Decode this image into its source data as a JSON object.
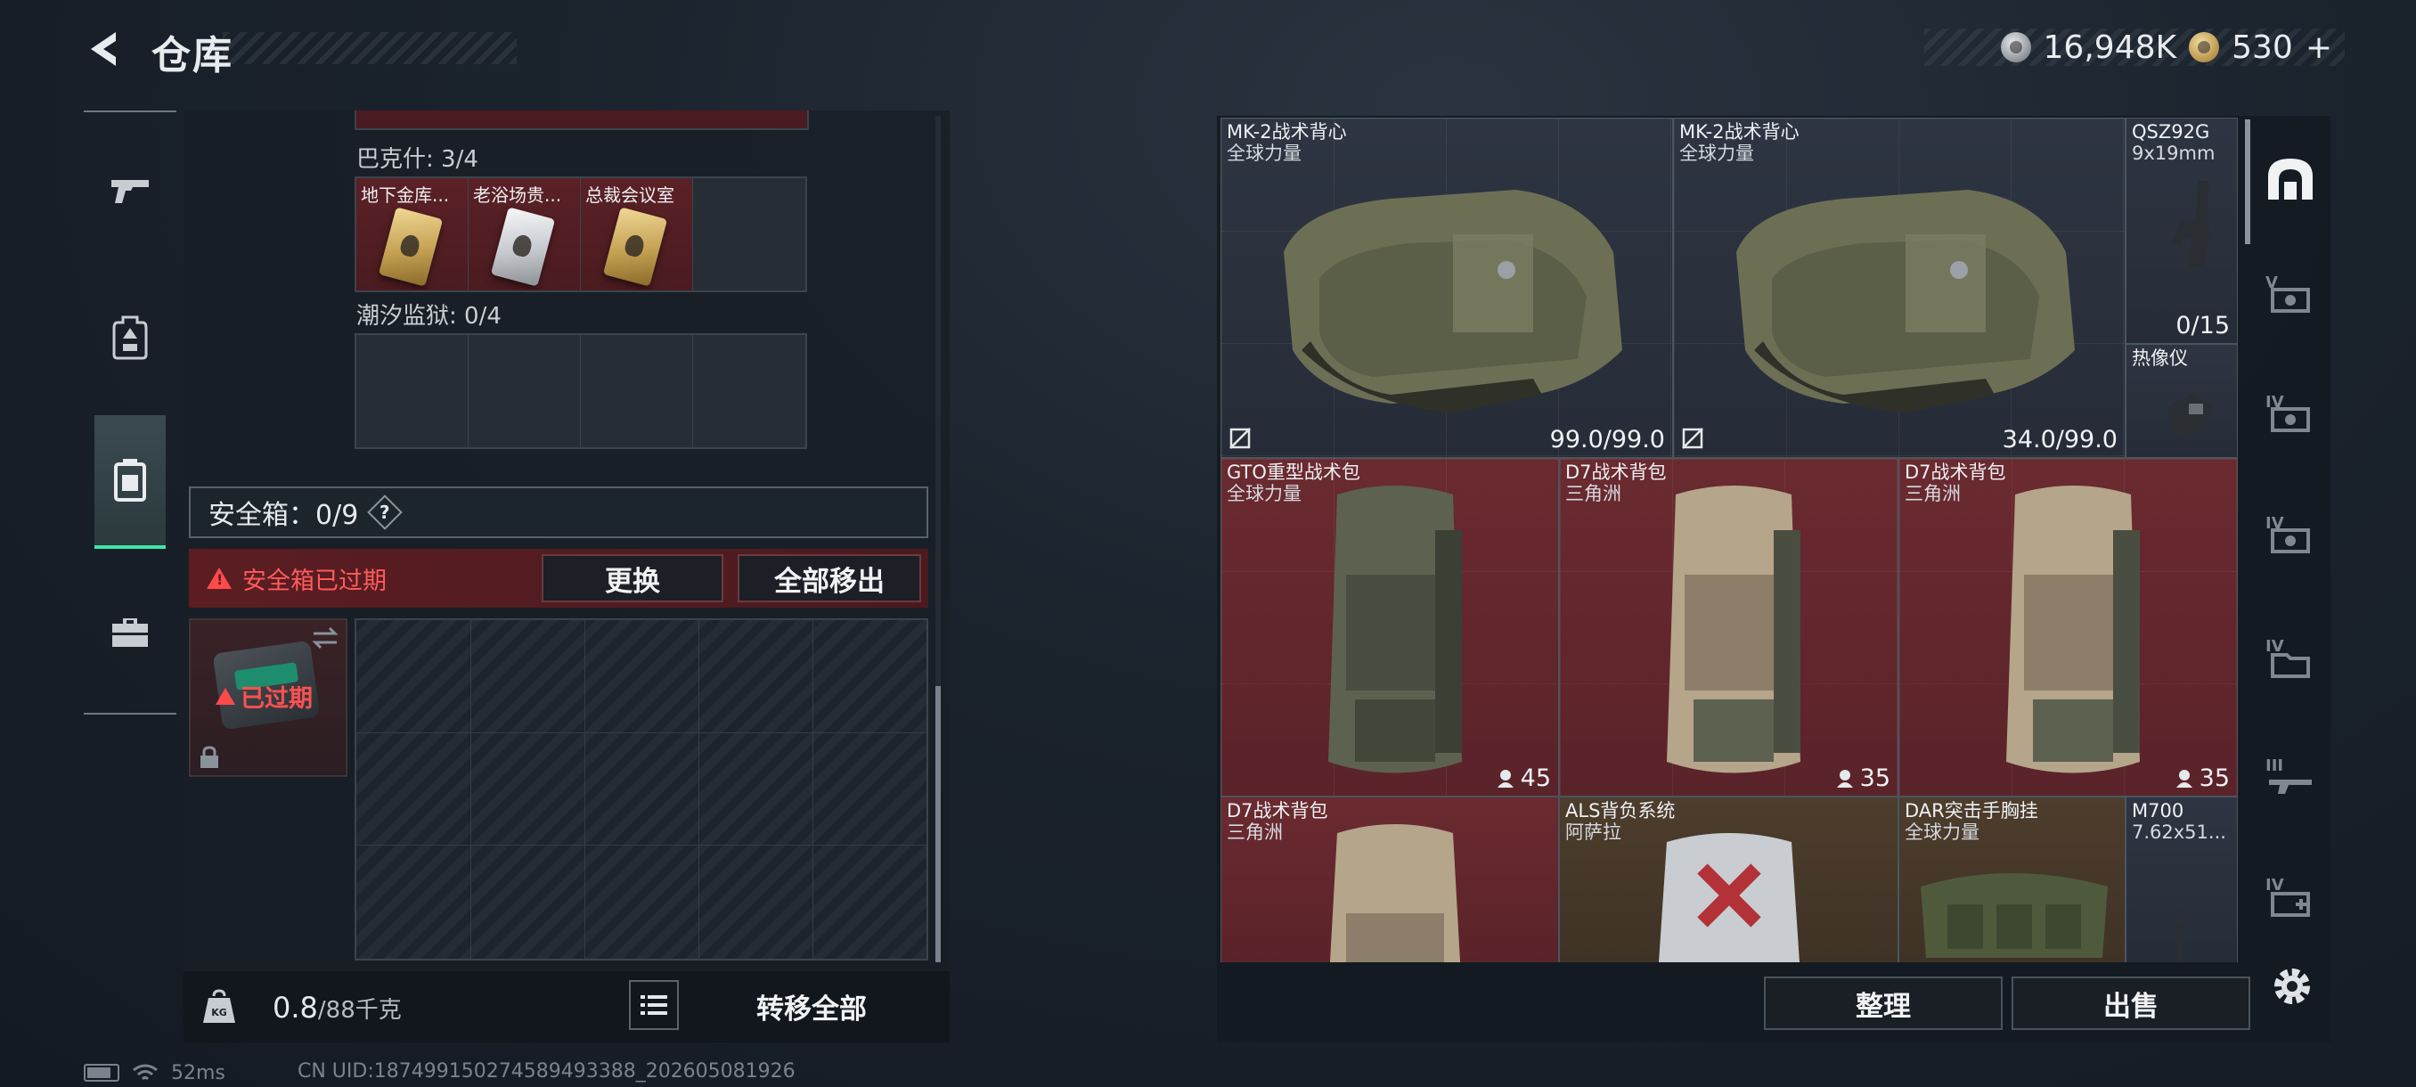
{
  "header": {
    "title": "仓库",
    "currency": {
      "silver_value": "16,948K",
      "gold_value": "530",
      "gold_plus": "+"
    }
  },
  "sidebar": {
    "items": [
      {
        "icon": "pistol-icon"
      },
      {
        "icon": "backpack-icon"
      },
      {
        "icon": "safebox-tab-icon",
        "active": true
      },
      {
        "icon": "briefcase-icon"
      }
    ]
  },
  "left": {
    "sections": [
      {
        "label": "巴克什: 3/4",
        "slots": [
          "地下金库...",
          "老浴场贵...",
          "总裁会议室",
          ""
        ],
        "cards": [
          "gold",
          "silver",
          "gold",
          ""
        ]
      },
      {
        "label": "潮汐监狱: 0/4",
        "slots": [
          "",
          "",
          "",
          ""
        ]
      }
    ],
    "safebox_title": "安全箱：0/9",
    "help": "?",
    "expired_warning": "安全箱已过期",
    "replace_button": "更换",
    "remove_all_button": "全部移出",
    "expired_badge": "已过期",
    "weight_value": "0.8",
    "weight_capacity": "/88千克",
    "transfer_all_button": "转移全部"
  },
  "right": {
    "cells": [
      {
        "name": "MK-2战术背心",
        "sub": "全球力量",
        "value": "99.0/99.0"
      },
      {
        "name": "MK-2战术背心",
        "sub": "全球力量",
        "value": "34.0/99.0"
      },
      {
        "name": "QSZ92G",
        "sub": "9x19mm",
        "value": "0/15"
      },
      {
        "name": "热像仪",
        "sub": "",
        "value": ""
      },
      {
        "name": "GTO重型战术包",
        "sub": "全球力量",
        "value": "45"
      },
      {
        "name": "D7战术背包",
        "sub": "三角洲",
        "value": "35"
      },
      {
        "name": "D7战术背包",
        "sub": "三角洲",
        "value": "35"
      },
      {
        "name": "D7战术背包",
        "sub": "三角洲",
        "value": ""
      },
      {
        "name": "ALS背负系统",
        "sub": "阿萨拉",
        "value": ""
      },
      {
        "name": "DAR突击手胸挂",
        "sub": "全球力量",
        "value": ""
      },
      {
        "name": "M700",
        "sub": "7.62x51...",
        "value": ""
      }
    ],
    "tabs": [
      "V",
      "IV",
      "IV",
      "IV",
      "III",
      "IV"
    ],
    "sort_button": "整理",
    "sell_button": "出售"
  },
  "status": {
    "ping": "52ms",
    "uid": "CN UID:1874991502745894933​88_202605081926"
  },
  "colors": {
    "accent_green": "#3ee7a6",
    "warning_red": "#ff4a4a",
    "item_red_bg": "#5a2329"
  }
}
